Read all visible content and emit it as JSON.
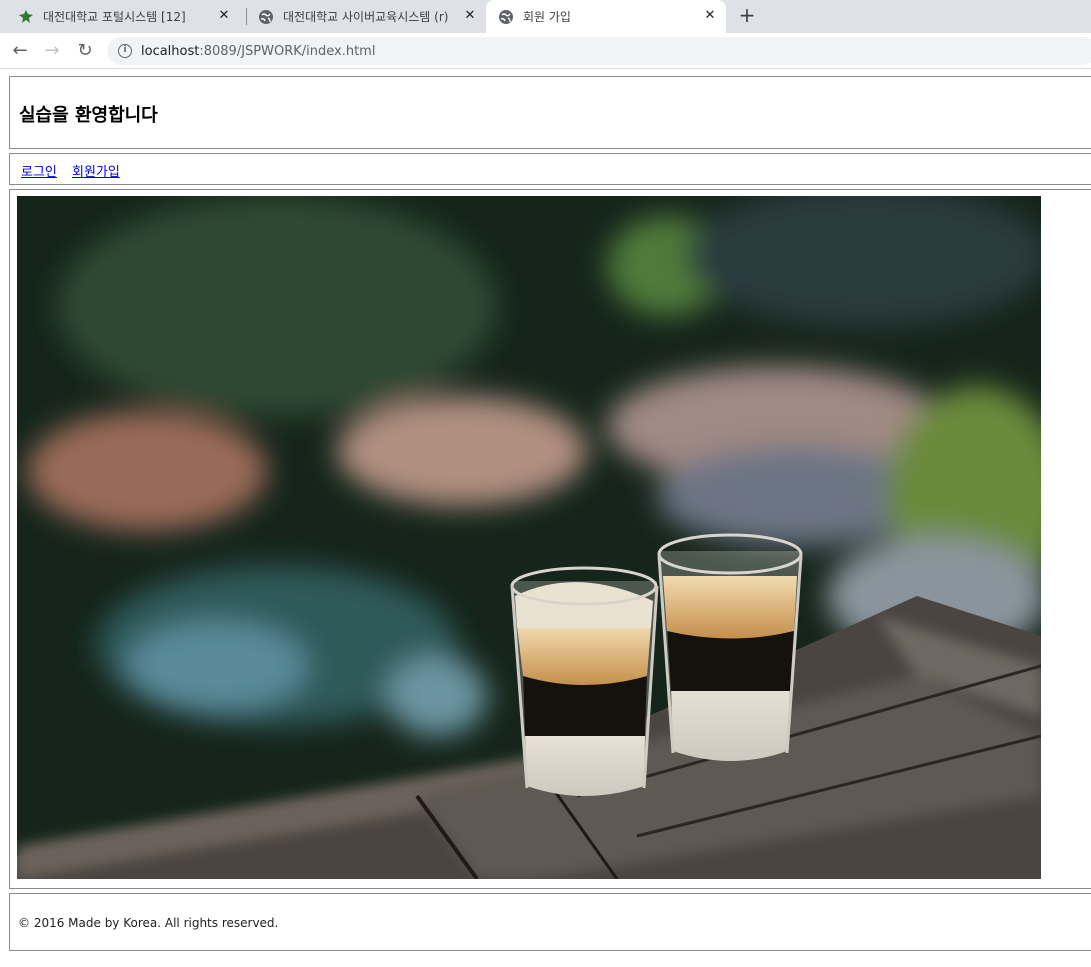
{
  "browser": {
    "tabs": [
      {
        "title": "대전대학교 포털시스템 [12]",
        "icon": "leaf-icon"
      },
      {
        "title": "대전대학교 사이버교육시스템 (r)",
        "icon": "globe-icon"
      },
      {
        "title": "회원 가입",
        "icon": "globe-icon",
        "active": true
      }
    ],
    "new_tab": "+",
    "back": "←",
    "forward": "→",
    "reload": "↻",
    "url_host": "localhost",
    "url_rest": ":8089/JSPWORK/index.html"
  },
  "page": {
    "heading": "실습을 환영합니다",
    "nav": {
      "login": "로그인",
      "signup": "회원가입"
    },
    "image": {
      "subject": "coffee-glasses-photo"
    },
    "footer": "© 2016 Made by Korea. All rights reserved."
  },
  "colors": {
    "link": "#0000ee",
    "tabbar_bg": "#dee1e6",
    "border": "#8c8c8c"
  }
}
